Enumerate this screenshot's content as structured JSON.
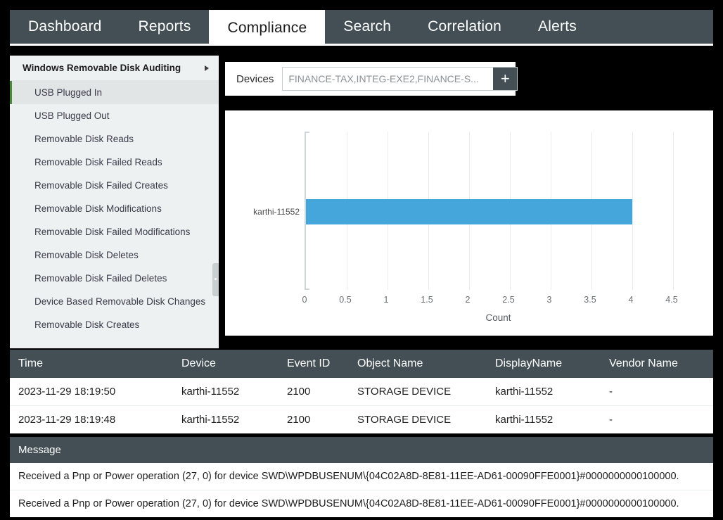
{
  "nav": {
    "tabs": [
      {
        "label": "Dashboard",
        "active": false
      },
      {
        "label": "Reports",
        "active": false
      },
      {
        "label": "Compliance",
        "active": true
      },
      {
        "label": "Search",
        "active": false
      },
      {
        "label": "Correlation",
        "active": false
      },
      {
        "label": "Alerts",
        "active": false
      }
    ]
  },
  "sidebar": {
    "header": "Windows Removable Disk Auditing",
    "items": [
      {
        "label": "USB Plugged In",
        "selected": true
      },
      {
        "label": "USB Plugged Out",
        "selected": false
      },
      {
        "label": "Removable Disk Reads",
        "selected": false
      },
      {
        "label": "Removable Disk Failed Reads",
        "selected": false
      },
      {
        "label": "Removable Disk Failed Creates",
        "selected": false
      },
      {
        "label": "Removable Disk Modifications",
        "selected": false
      },
      {
        "label": "Removable Disk Failed Modifications",
        "selected": false
      },
      {
        "label": "Removable Disk Deletes",
        "selected": false
      },
      {
        "label": "Removable Disk Failed Deletes",
        "selected": false
      },
      {
        "label": "Device Based Removable Disk Changes",
        "selected": false
      },
      {
        "label": "Removable Disk Creates",
        "selected": false
      }
    ]
  },
  "filter": {
    "label": "Devices",
    "value": "FINANCE-TAX,INTEG-EXE2,FINANCE-S...",
    "placeholder": "FINANCE-TAX,INTEG-EXE2,FINANCE-S...",
    "add_label": "+"
  },
  "chart_data": {
    "type": "bar",
    "orientation": "horizontal",
    "categories": [
      "karthi-11552"
    ],
    "values": [
      4
    ],
    "title": "",
    "xlabel": "Count",
    "ylabel": "",
    "xlim": [
      0,
      4.75
    ],
    "xticks": [
      "0",
      "0.5",
      "1",
      "1.5",
      "2",
      "2.5",
      "3",
      "3.5",
      "4",
      "4.5"
    ],
    "xtick_values": [
      0,
      0.5,
      1,
      1.5,
      2,
      2.5,
      3,
      3.5,
      4,
      4.5
    ],
    "grid": true,
    "legend": false,
    "bar_color": "#45a6dc"
  },
  "events": {
    "columns": [
      "Time",
      "Device",
      "Event ID",
      "Object Name",
      "DisplayName",
      "Vendor Name"
    ],
    "rows": [
      {
        "time": "2023-11-29 18:19:50",
        "device": "karthi-11552",
        "event_id": "2100",
        "object_name": "STORAGE DEVICE",
        "display_name": "karthi-11552",
        "vendor_name": "-"
      },
      {
        "time": "2023-11-29 18:19:48",
        "device": "karthi-11552",
        "event_id": "2100",
        "object_name": "STORAGE DEVICE",
        "display_name": "karthi-11552",
        "vendor_name": "-"
      }
    ]
  },
  "messages": {
    "header": "Message",
    "rows": [
      "Received a Pnp or Power operation (27, 0) for device SWD\\WPDBUSENUM\\{04C02A8D-8E81-11EE-AD61-00090FFE0001}#0000000000100000.",
      "Received a Pnp or Power operation (27, 0) for device SWD\\WPDBUSENUM\\{04C02A8D-8E81-11EE-AD61-00090FFE0001}#0000000000100000."
    ]
  }
}
